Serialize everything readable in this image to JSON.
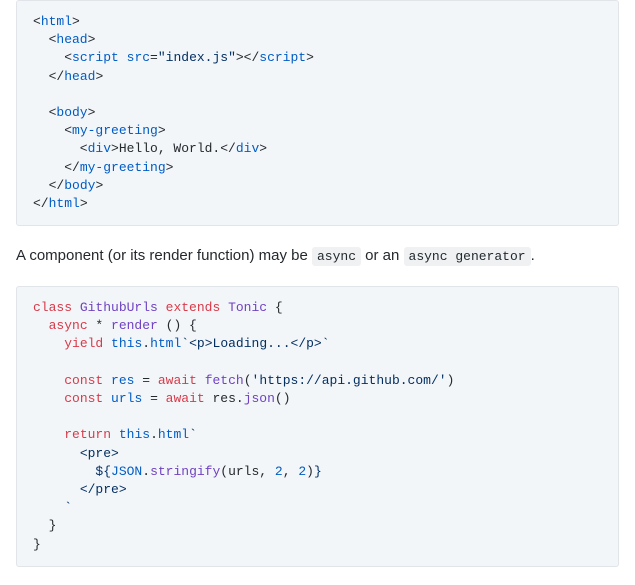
{
  "code1": {
    "l1a": "<",
    "l1b": "html",
    "l1c": ">",
    "l2a": "  <",
    "l2b": "head",
    "l2c": ">",
    "l3a": "    <",
    "l3b": "script",
    "l3c": " ",
    "l3d": "src",
    "l3e": "=",
    "l3f": "\"index.js\"",
    "l3g": "></",
    "l3h": "script",
    "l3i": ">",
    "l4a": "  </",
    "l4b": "head",
    "l4c": ">",
    "blank1": "",
    "l5a": "  <",
    "l5b": "body",
    "l5c": ">",
    "l6a": "    <",
    "l6b": "my-greeting",
    "l6c": ">",
    "l7a": "      <",
    "l7b": "div",
    "l7c": ">Hello, World.</",
    "l7d": "div",
    "l7e": ">",
    "l8a": "    </",
    "l8b": "my-greeting",
    "l8c": ">",
    "l9a": "  </",
    "l9b": "body",
    "l9c": ">",
    "l10a": "</",
    "l10b": "html",
    "l10c": ">"
  },
  "prose": {
    "t1": "A component (or its render function) may be ",
    "c1": "async",
    "t2": " or an ",
    "c2": "async generator",
    "t3": "."
  },
  "code2": {
    "l1a": "class",
    "l1b": " ",
    "l1c": "GithubUrls",
    "l1d": " ",
    "l1e": "extends",
    "l1f": " ",
    "l1g": "Tonic",
    "l1h": " {",
    "l2a": "  ",
    "l2b": "async",
    "l2c": " * ",
    "l2d": "render",
    "l2e": " () {",
    "l3a": "    ",
    "l3b": "yield",
    "l3c": " ",
    "l3d": "this",
    "l3e": ".",
    "l3f": "html",
    "l3g": "`",
    "l3h": "<p>Loading...</p>",
    "l3i": "`",
    "blank1": "",
    "l4a": "    ",
    "l4b": "const",
    "l4c": " ",
    "l4d": "res",
    "l4e": " = ",
    "l4f": "await",
    "l4g": " ",
    "l4h": "fetch",
    "l4i": "(",
    "l4j": "'https://api.github.com/'",
    "l4k": ")",
    "l5a": "    ",
    "l5b": "const",
    "l5c": " ",
    "l5d": "urls",
    "l5e": " = ",
    "l5f": "await",
    "l5g": " res.",
    "l5h": "json",
    "l5i": "()",
    "blank2": "",
    "l6a": "    ",
    "l6b": "return",
    "l6c": " ",
    "l6d": "this",
    "l6e": ".",
    "l6f": "html",
    "l6g": "`",
    "l7a": "      ",
    "l7b": "<pre>",
    "l8a": "        ",
    "l8b": "${",
    "l8c": "JSON",
    "l8d": ".",
    "l8e": "stringify",
    "l8f": "(urls, ",
    "l8g": "2",
    "l8h": ", ",
    "l8i": "2",
    "l8j": ")",
    "l8k": "}",
    "l9a": "      ",
    "l9b": "</pre>",
    "l10a": "    `",
    "l11a": "  }",
    "l12a": "}"
  }
}
